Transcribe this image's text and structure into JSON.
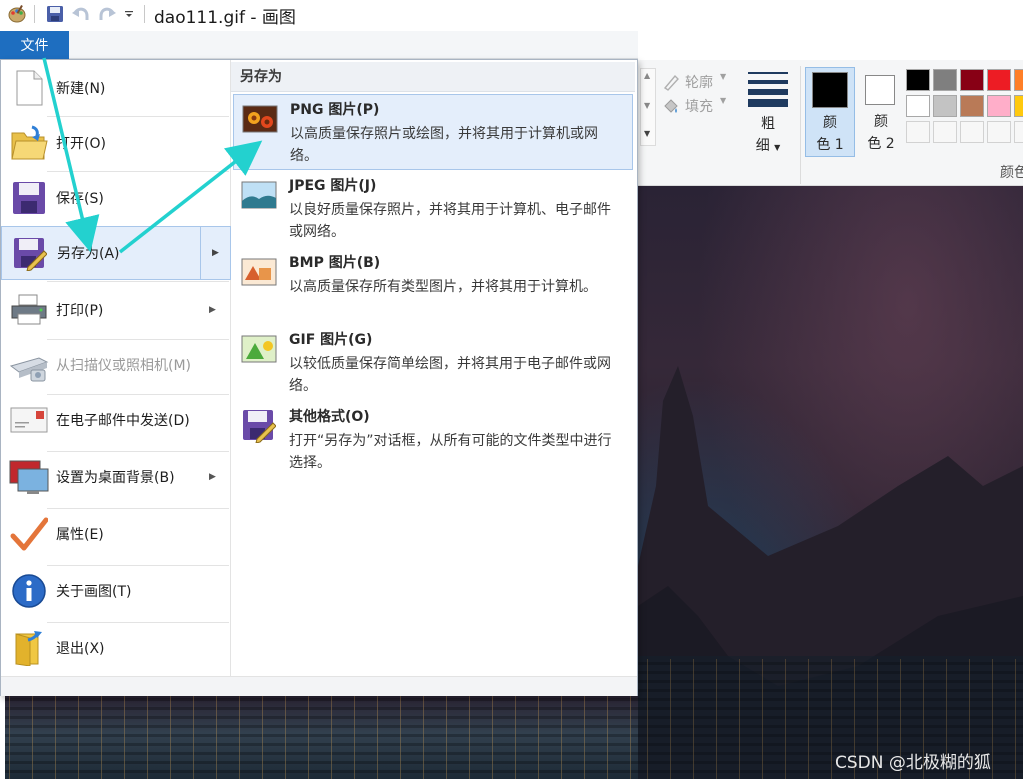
{
  "window": {
    "title": "dao111.gif - 画图"
  },
  "quick_access": {
    "icons": [
      "paint-app-icon",
      "save-icon",
      "undo-icon",
      "redo-icon",
      "customize-dropdown-icon"
    ]
  },
  "file_tab": {
    "label": "文件"
  },
  "ribbon": {
    "outline_label": "轮廓",
    "fill_label": "填充",
    "size_label_line1": "粗",
    "size_label_line2": "细",
    "color1_line1": "颜",
    "color1_line2": "色 1",
    "color2_line1": "颜",
    "color2_line2": "色 2",
    "colors_group_label": "颜色",
    "color1_value": "#000000",
    "color2_value": "#ffffff",
    "palette_row1": [
      "#000000",
      "#7f7f7f",
      "#880015",
      "#ed1c24",
      "#ff7f27"
    ],
    "palette_row2": [
      "#ffffff",
      "#c3c3c3",
      "#b97a57",
      "#ffaec9",
      "#ffc90e"
    ]
  },
  "file_menu": {
    "items": [
      {
        "label": "新建(N)",
        "icon": "new-file-icon"
      },
      {
        "label": "打开(O)",
        "icon": "open-folder-icon"
      },
      {
        "label": "保存(S)",
        "icon": "save-disk-icon"
      },
      {
        "label": "另存为(A)",
        "icon": "save-as-icon",
        "selected": true
      },
      {
        "label": "打印(P)",
        "icon": "printer-icon"
      },
      {
        "label": "从扫描仪或照相机(M)",
        "icon": "scanner-icon",
        "disabled": true
      },
      {
        "label": "在电子邮件中发送(D)",
        "icon": "email-icon"
      },
      {
        "label": "设置为桌面背景(B)",
        "icon": "desktop-background-icon"
      },
      {
        "label": "属性(E)",
        "icon": "checkmark-icon"
      },
      {
        "label": "关于画图(T)",
        "icon": "info-icon"
      },
      {
        "label": "退出(X)",
        "icon": "exit-icon"
      }
    ]
  },
  "save_as_submenu": {
    "header": "另存为",
    "items": [
      {
        "title": "PNG 图片(P)",
        "description": "以高质量保存照片或绘图，并将其用于计算机或网络。",
        "icon": "png-image-icon",
        "selected": true
      },
      {
        "title": "JPEG 图片(J)",
        "description": "以良好质量保存照片，并将其用于计算机、电子邮件或网络。",
        "icon": "jpeg-image-icon"
      },
      {
        "title": "BMP 图片(B)",
        "description": "以高质量保存所有类型图片，并将其用于计算机。",
        "icon": "bmp-image-icon"
      },
      {
        "title": "GIF 图片(G)",
        "description": "以较低质量保存简单绘图，并将其用于电子邮件或网络。",
        "icon": "gif-image-icon"
      },
      {
        "title": "其他格式(O)",
        "description": "打开“另存为”对话框，从所有可能的文件类型中进行选择。",
        "icon": "other-formats-icon"
      }
    ]
  },
  "watermark": "CSDN @北极糊的狐",
  "colors": {
    "accent": "#1e6ec0",
    "selection": "#e4eefb",
    "annotation_arrow": "#23d1cf"
  }
}
